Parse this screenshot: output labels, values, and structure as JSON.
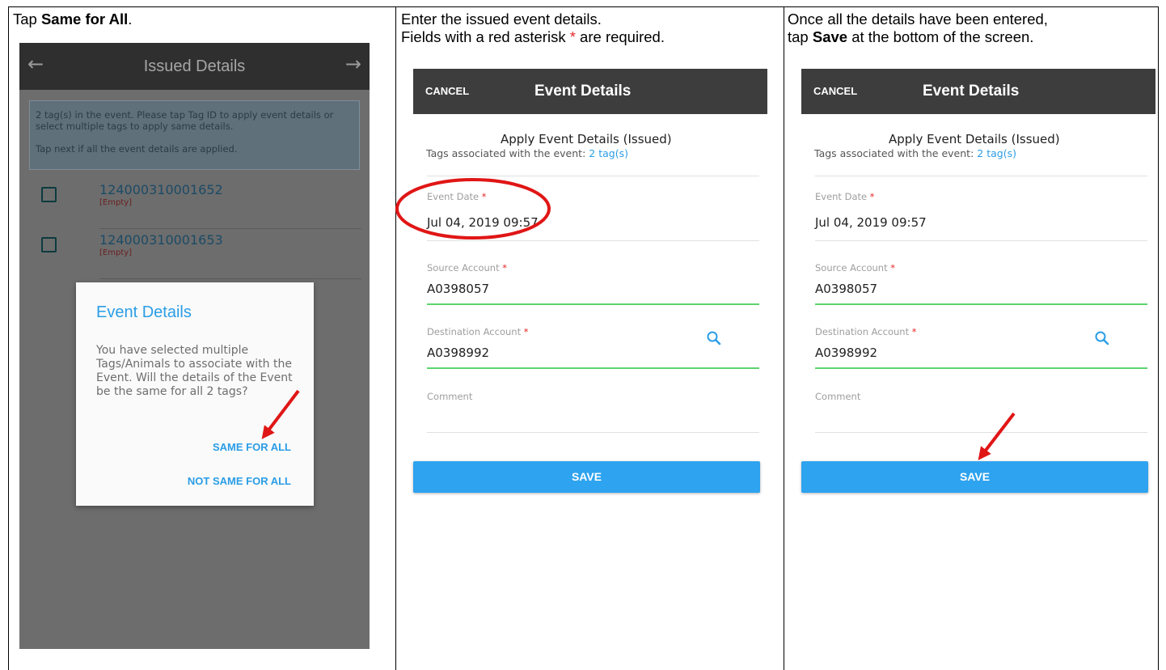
{
  "captions": {
    "step1_prefix": "Tap ",
    "step1_bold": "Same for All",
    "step1_suffix": ".",
    "step2_line1": "Enter the issued event details.",
    "step2_line2_prefix": "Fields with a red asterisk ",
    "step2_asterisk": "*",
    "step2_line2_suffix": " are required.",
    "step3_line1": "Once all the details have been entered,",
    "step3_line2_prefix": "tap ",
    "step3_bold": "Save",
    "step3_line2_suffix": " at the bottom of the screen."
  },
  "screen1": {
    "back_icon": "arrow-left-icon",
    "back_glyph": "←",
    "title": "Issued Details",
    "next_icon": "arrow-right-icon",
    "next_glyph": "→",
    "info_line1": "2 tag(s) in the event. Please tap Tag ID to apply event details or",
    "info_line2": "select multiple tags to apply same details.",
    "info_line3": "Tap next if all the event details are applied.",
    "tags": [
      {
        "id": "124000310001652",
        "status": "[Empty]"
      },
      {
        "id": "124000310001653",
        "status": "[Empty]"
      }
    ],
    "dialog": {
      "title": "Event Details",
      "body": "You have selected multiple Tags/Animals to associate with the Event. Will the details of the Event be the same for all 2 tags?",
      "same_label": "SAME FOR ALL",
      "not_same_label": "NOT SAME FOR ALL"
    }
  },
  "event_form": {
    "cancel_label": "CANCEL",
    "title": "Event Details",
    "apply_heading": "Apply Event Details (Issued)",
    "assoc_prefix": "Tags associated with the event: ",
    "assoc_link": "2 tag(s)",
    "event_date_label": "Event Date",
    "required_mark": "*",
    "event_date_value": "Jul 04, 2019 09:57",
    "source_label": "Source Account",
    "source_value": "A0398057",
    "destination_label": "Destination Account",
    "destination_value": "A0398992",
    "search_icon": "search-icon",
    "comment_label": "Comment",
    "save_label": "SAVE"
  },
  "colors": {
    "accent_blue": "#2a9de6",
    "save_button": "#2ea3ef",
    "annotation_red": "#e01616",
    "field_underline_green": "#5dd46e",
    "app_bar_dark": "#3d3d3d"
  }
}
